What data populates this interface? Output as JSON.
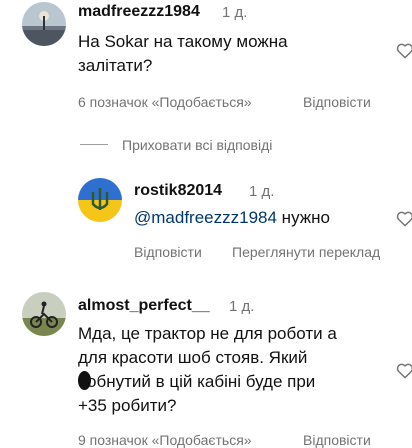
{
  "comments": [
    {
      "username": "madfreezzz1984",
      "time": "1 д.",
      "text_lines": [
        "На Sokar на такому можна",
        "залітати?"
      ],
      "likes": "6 позначок «Подобається»",
      "reply": "Відповісти",
      "avatar": "landscape-avatar",
      "heart": "heart-outline-icon"
    },
    {
      "username": "rostik82014",
      "time": "1 д.",
      "mention": "@madfreezzz1984",
      "text_after": " нужно",
      "reply": "Відповісти",
      "translate": "Переглянути переклад",
      "avatar": "ukraine-flag-trident-avatar",
      "heart": "heart-outline-icon"
    },
    {
      "username": "almost_perfect__",
      "time": "1 д.",
      "text_lines": [
        "Мда, це трактор не для роботи а",
        "для красоти шоб стояв. Який",
        "обнутий в цій кабіні буде при",
        "+35 робити?"
      ],
      "likes": "9 позначок «Подобається»",
      "reply": "Відповісти",
      "avatar": "motorcycle-field-avatar",
      "heart": "heart-outline-icon"
    }
  ],
  "hide_replies": "Приховати всі відповіді"
}
